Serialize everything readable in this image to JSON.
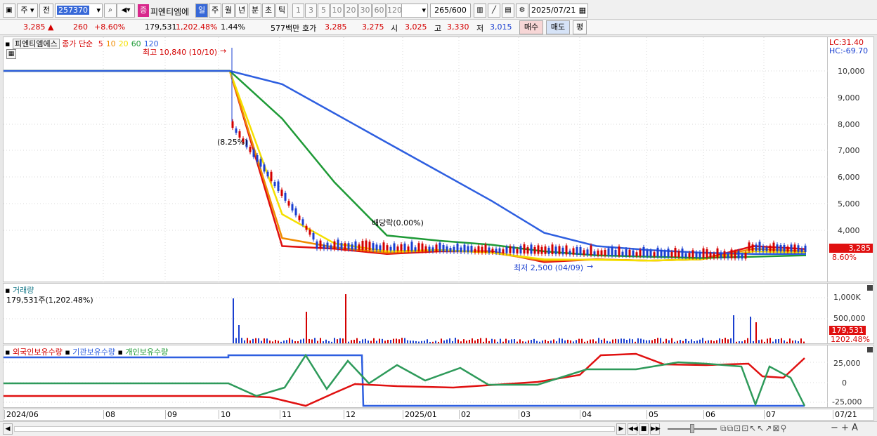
{
  "toolbar": {
    "type_select": "주",
    "prev_label": "전",
    "code": "257370",
    "badge": "증",
    "stock_name": "피엔티엠에",
    "periods": [
      "일",
      "주",
      "월",
      "년",
      "분",
      "초",
      "틱"
    ],
    "intervals": [
      "1",
      "3",
      "5",
      "10",
      "20",
      "30",
      "60",
      "120"
    ],
    "count": "265",
    "count_max": "/600",
    "date": "2025/07/21"
  },
  "quote": {
    "price": "3,285",
    "change": "260",
    "change_pct": "+8.60%",
    "volume": "179,531",
    "volume_pct": "1,202.48%",
    "turnover_pct": "1.44%",
    "amount": "577백만",
    "ask_label": "호가",
    "ask": "3,285",
    "bid": "3,275",
    "open_label": "시",
    "open": "3,025",
    "high_label": "고",
    "high": "3,330",
    "low_label": "저",
    "low": "3,015",
    "buy": "매수",
    "sell": "매도",
    "eval": "평"
  },
  "price_panel": {
    "name": "피엔티엠에스",
    "ma_label": "종가 단순",
    "ma_periods": [
      "5",
      "10",
      "20",
      "60",
      "120"
    ],
    "ma_colors": [
      "#e01010",
      "#f08c00",
      "#f5e000",
      "#1e9a36",
      "#2e5fe0"
    ],
    "high_note": "최고 10,840 (10/10)",
    "low_note": "최저 2,500 (04/09)",
    "dividend_note": "배당락(0.00%)",
    "event_note": "(8.25%)",
    "lc": "LC:31.40",
    "hc": "HC:-69.70",
    "price_tag": "3,285",
    "pct_tag": "8.60%",
    "y_ticks": [
      "10,000",
      "9,000",
      "8,000",
      "7,000",
      "6,000",
      "5,000",
      "4,000"
    ]
  },
  "volume_panel": {
    "title": "거래량",
    "info": "179,531주(1,202.48%)",
    "y_ticks": [
      "1,000K",
      "500,000"
    ],
    "vol_tag": "179,531",
    "vol_pct_tag": "1202.48%"
  },
  "holding_panel": {
    "legend": [
      "외국인보유수량",
      "기관보유수량",
      "개인보유수량"
    ],
    "legend_colors": [
      "#e01010",
      "#2e5fe0",
      "#1e9a36"
    ],
    "y_ticks": [
      "25,000",
      "0",
      "-25,000"
    ]
  },
  "x_axis": {
    "labels": [
      "2024/06",
      "08",
      "09",
      "10",
      "11",
      "12",
      "2025/01",
      "02",
      "03",
      "04",
      "05",
      "06",
      "07",
      "07/21"
    ]
  },
  "chart_data": {
    "type": "line",
    "series": [
      {
        "name": "5",
        "values": [
          10000,
          10000,
          10000,
          10000,
          3400,
          3300,
          3100,
          3200,
          3200,
          2800,
          2900,
          2850,
          2900,
          3400,
          3285
        ]
      },
      {
        "name": "10",
        "values": [
          10000,
          10000,
          10000,
          10000,
          3700,
          3350,
          3150,
          3250,
          3150,
          2850,
          2900,
          2850,
          2900,
          3300,
          3200
        ]
      },
      {
        "name": "20",
        "values": [
          10000,
          10000,
          10000,
          10000,
          4600,
          3500,
          3200,
          3250,
          3150,
          2900,
          2880,
          2850,
          2900,
          3200,
          3150
        ]
      },
      {
        "name": "60",
        "values": [
          10000,
          10000,
          10000,
          10000,
          8200,
          5800,
          3800,
          3600,
          3450,
          3200,
          3050,
          3000,
          2950,
          3000,
          3050
        ]
      },
      {
        "name": "120",
        "values": [
          10000,
          10000,
          10000,
          10000,
          9500,
          8400,
          7300,
          6200,
          5100,
          3900,
          3400,
          3250,
          3150,
          3100,
          3100
        ]
      }
    ]
  }
}
